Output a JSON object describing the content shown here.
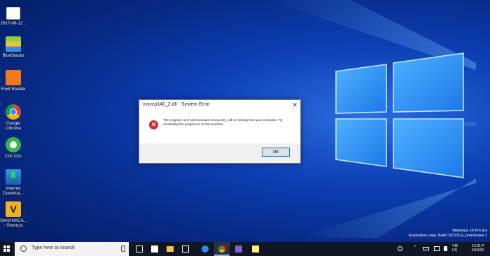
{
  "desktop": {
    "icons": [
      {
        "label": "2017-06-12...",
        "icon": "document-icon"
      },
      {
        "label": "BlueStacks",
        "icon": "bluestacks-icon"
      },
      {
        "label": "Foxit Reader",
        "icon": "foxit-reader-icon"
      },
      {
        "label": "Google\nChrome",
        "icon": "chrome-icon"
      },
      {
        "label": "Cốc Cốc",
        "icon": "coccoc-icon"
      },
      {
        "label": "Internet\nDownloa...",
        "icon": "internet-download-manager-icon"
      },
      {
        "label": "SimVINACA...\n- Shortcut",
        "icon": "simvinacad-icon"
      }
    ]
  },
  "dialog": {
    "title": "msvcp140_2.dll - System Error",
    "close_glyph": "✕",
    "message": "The program can’t start because msvcp140_2.dll is missing from your computer. Try reinstalling the program to fix this problem.",
    "error_glyph": "✕",
    "ok_label": "OK"
  },
  "watermark": {
    "line1": "Windows 10 Pro Ins",
    "line2": "Evaluation copy. Build 16215.rs_prerelease.1"
  },
  "taskbar": {
    "search_placeholder": "Type here to search",
    "apps": [
      "task-view-icon",
      "store-icon",
      "file-explorer-icon",
      "photos-icon",
      "edge-icon",
      "chrome-icon",
      "visual-studio-icon",
      "sticky-notes-icon"
    ],
    "active_app": "chrome-icon",
    "language_line1": "VIE",
    "language_line2": "US",
    "time": "10:31 P",
    "date": "6/19/20"
  },
  "colors": {
    "desktop_accent": "#0d3fb5",
    "error_red": "#d9262a",
    "ok_border": "#0078d7",
    "taskbar_bg": "#101623"
  }
}
